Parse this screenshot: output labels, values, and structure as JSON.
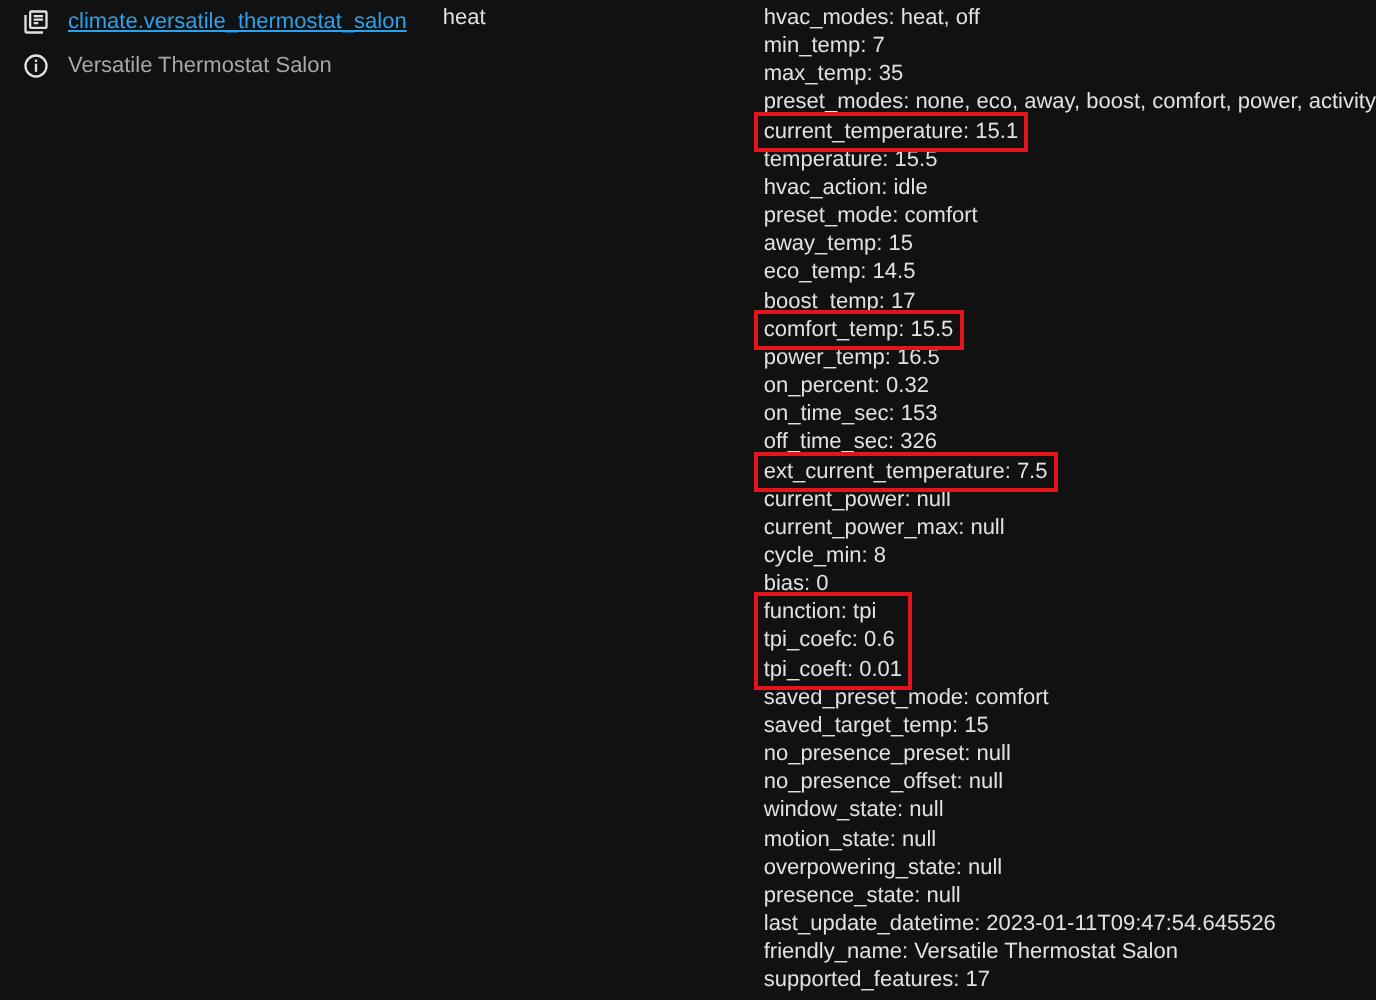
{
  "entity": {
    "id": "climate.versatile_thermostat_salon",
    "name": "Versatile Thermostat Salon"
  },
  "state": "heat",
  "attribute_groups": [
    {
      "highlighted": false,
      "lines": [
        "hvac_modes: heat, off",
        "min_temp: 7",
        "max_temp: 35",
        "preset_modes: none, eco, away, boost, comfort, power, activity"
      ]
    },
    {
      "highlighted": true,
      "lines": [
        "current_temperature: 15.1"
      ]
    },
    {
      "highlighted": false,
      "lines": [
        "temperature: 15.5",
        "hvac_action: idle",
        "preset_mode: comfort",
        "away_temp: 15",
        "eco_temp: 14.5",
        "boost_temp: 17"
      ]
    },
    {
      "highlighted": true,
      "lines": [
        "comfort_temp: 15.5"
      ]
    },
    {
      "highlighted": false,
      "lines": [
        "power_temp: 16.5",
        "on_percent: 0.32",
        "on_time_sec: 153",
        "off_time_sec: 326"
      ]
    },
    {
      "highlighted": true,
      "lines": [
        "ext_current_temperature: 7.5"
      ]
    },
    {
      "highlighted": false,
      "lines": [
        "current_power: null",
        "current_power_max: null",
        "cycle_min: 8",
        "bias: 0"
      ]
    },
    {
      "highlighted": true,
      "lines": [
        "function: tpi",
        "tpi_coefc: 0.6",
        "tpi_coeft: 0.01"
      ]
    },
    {
      "highlighted": false,
      "lines": [
        "saved_preset_mode: comfort",
        "saved_target_temp: 15",
        "no_presence_preset: null",
        "no_presence_offset: null",
        "window_state: null",
        "motion_state: null",
        "overpowering_state: null",
        "presence_state: null",
        "last_update_datetime: 2023-01-11T09:47:54.645526",
        "friendly_name: Versatile Thermostat Salon",
        "supported_features: 17"
      ]
    }
  ]
}
